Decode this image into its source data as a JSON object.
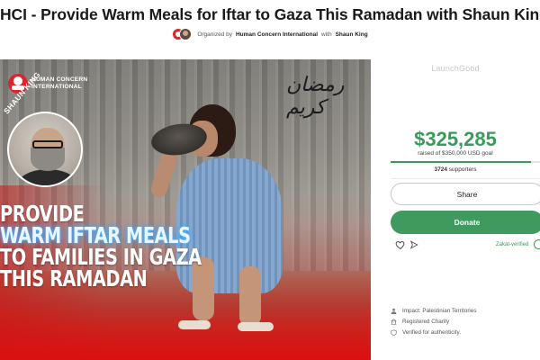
{
  "title": "HCI - Provide Warm Meals for Iftar to Gaza This Ramadan with Shaun King",
  "organizer": {
    "prefix": "Organized by",
    "org": "Human Concern International",
    "with": "with",
    "person": "Shaun King"
  },
  "hero": {
    "logo_text": "HUMAN CONCERN INTERNATIONAL",
    "shaun_label": "SHAUN KING",
    "arabic_text": "رمضان كريم",
    "headline": [
      "PROVIDE",
      "WARM IFTAR MEALS",
      "TO FAMILIES IN GAZA",
      "THIS RAMADAN"
    ]
  },
  "panel": {
    "platform": "LaunchGood",
    "amount": "$325,285",
    "goal_text": "raised of $350,000 USD goal",
    "progress_fraction": 0.929,
    "supporters_count": "3724",
    "supporters_label": "supporters",
    "share_label": "Share",
    "donate_label": "Donate",
    "zakat_label": "Zakat-verified",
    "info": [
      {
        "icon": "person-icon",
        "text": "Impact: Palestinian Territories"
      },
      {
        "icon": "building-icon",
        "text": "Registered Charity"
      },
      {
        "icon": "shield-check-icon",
        "text": "Verified for authenticity."
      }
    ]
  },
  "colors": {
    "accent_green": "#3b9a5b",
    "brand_red": "#d8262c"
  }
}
